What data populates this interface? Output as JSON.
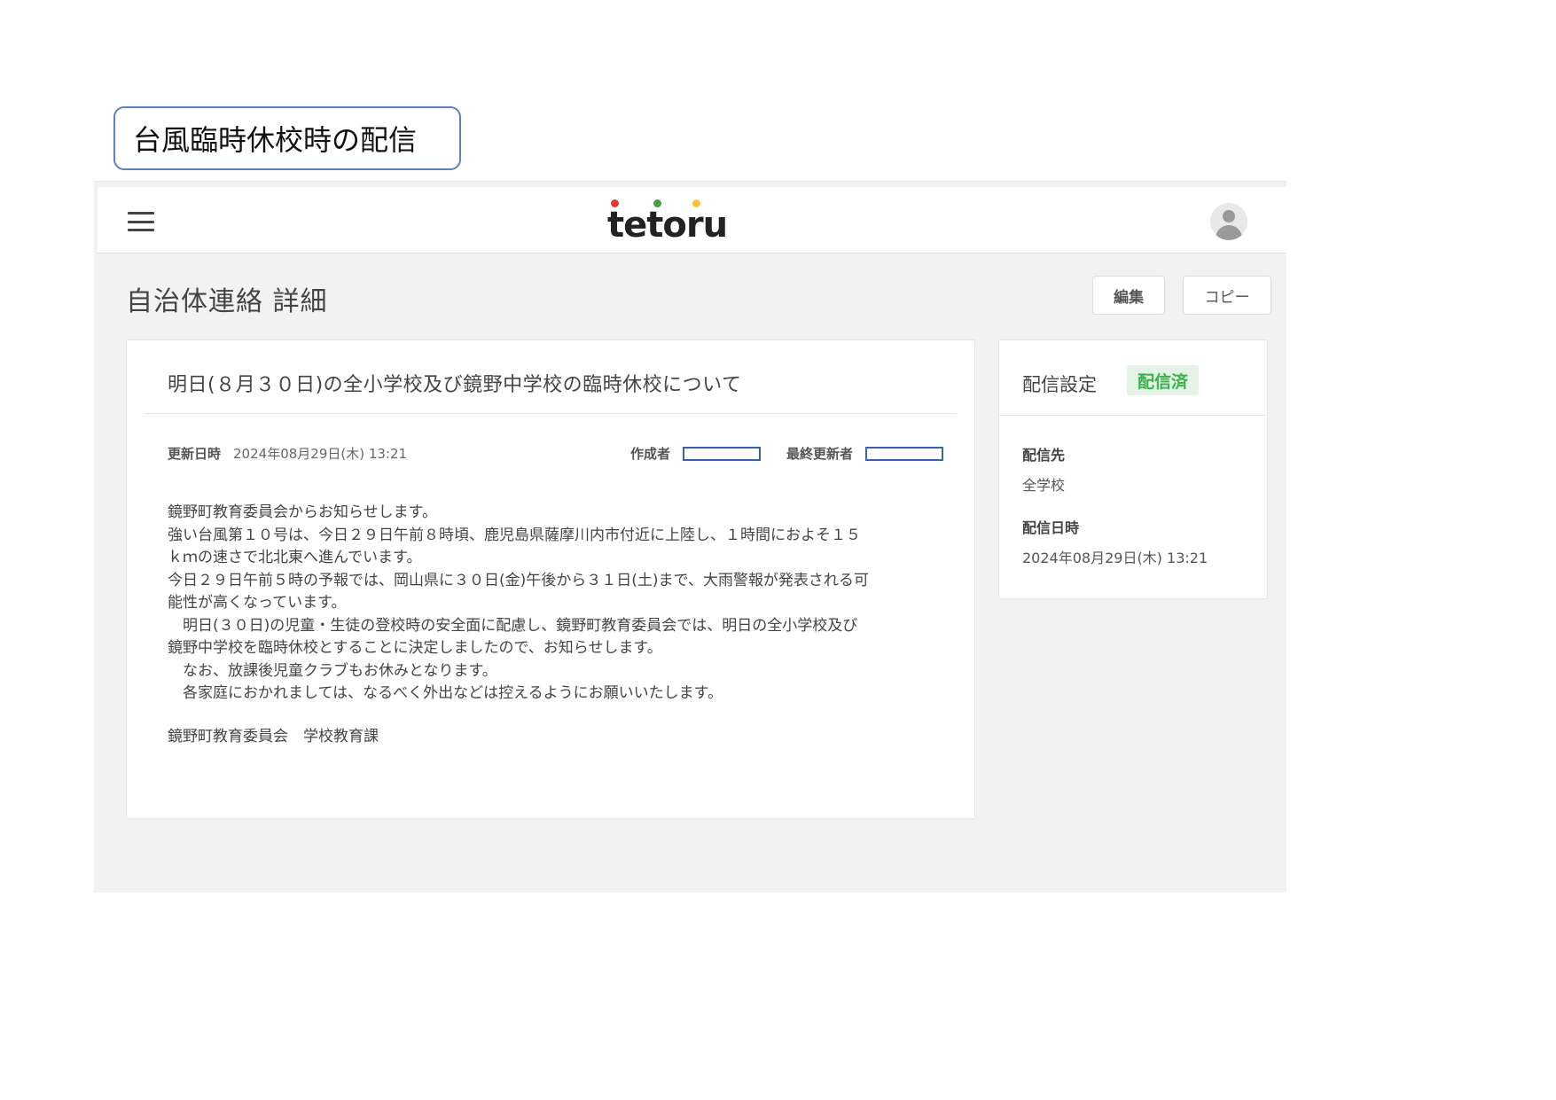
{
  "caption": "台風臨時休校時の配信",
  "header": {
    "logo_text": "tetoru",
    "logo_dots": [
      "#e53935",
      "#43a047",
      "#fbc02d"
    ],
    "menu_icon": "hamburger-menu-icon",
    "avatar_icon": "user-avatar-icon"
  },
  "page": {
    "title": "自治体連絡 詳細",
    "edit_label": "編集",
    "copy_label": "コピー"
  },
  "message": {
    "title": "明日(８月３０日)の全小学校及び鏡野中学校の臨時休校について",
    "updated_label": "更新日時",
    "updated_value": "2024年08月29日(木) 13:21",
    "author_label": "作成者",
    "last_updater_label": "最終更新者",
    "body": [
      "鏡野町教育委員会からお知らせします。",
      "強い台風第１０号は、今日２９日午前８時頃、鹿児島県薩摩川内市付近に上陸し、１時間におよそ１５",
      "ｋｍの速さで北北東へ進んでいます。",
      "今日２９日午前５時の予報では、岡山県に３０日(金)午後から３１日(土)まで、大雨警報が発表される可",
      "能性が高くなっています。",
      "　明日(３０日)の児童・生徒の登校時の安全面に配慮し、鏡野町教育委員会では、明日の全小学校及び",
      "鏡野中学校を臨時休校とすることに決定しましたので、お知らせします。",
      "　なお、放課後児童クラブもお休みとなります。",
      "　各家庭におかれましては、なるべく外出などは控えるようにお願いいたします。"
    ],
    "signature": "鏡野町教育委員会　学校教育課"
  },
  "delivery": {
    "title": "配信設定",
    "status": "配信済",
    "status_color": "#3bb24b",
    "target_label": "配信先",
    "target_value": "全学校",
    "datetime_label": "配信日時",
    "datetime_value": "2024年08月29日(木) 13:21"
  }
}
